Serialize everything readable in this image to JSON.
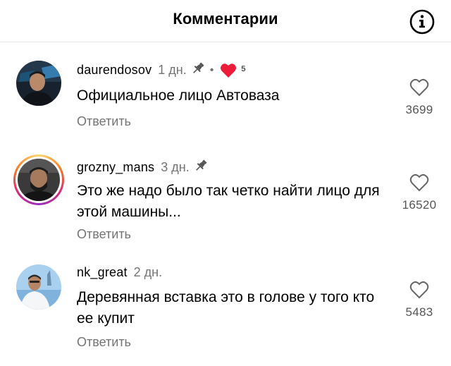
{
  "header": {
    "title": "Комментарии",
    "info_icon": "info-circle-icon"
  },
  "comments": [
    {
      "username": "daurendosov",
      "time": "1 дн.",
      "pinned": true,
      "separator": "•",
      "liked_by_author": true,
      "badge": "5",
      "text": "Официальное лицо Автоваза",
      "reply_label": "Ответить",
      "likes": "3699",
      "avatar_colors": {
        "bg": "#1c2a3a",
        "glow": "#3aa0d8"
      }
    },
    {
      "username": "grozny_mans",
      "time": "3 дн.",
      "pinned": true,
      "has_story": true,
      "text": "Это же надо было так четко найти лицо для этой машины...",
      "reply_label": "Ответить",
      "likes": "16520",
      "avatar_colors": {
        "bg": "#2b2b2b"
      }
    },
    {
      "username": "nk_great",
      "time": "2 дн.",
      "pinned": false,
      "text": "Деревянная вставка это в голове у того кто ее купит",
      "reply_label": "Ответить",
      "likes": "5483",
      "avatar_colors": {
        "bg": "#9cc6ea"
      }
    }
  ],
  "colors": {
    "secondary_text": "#737373",
    "heart_red": "#ed1c3b",
    "divider": "#e6e6e6"
  }
}
